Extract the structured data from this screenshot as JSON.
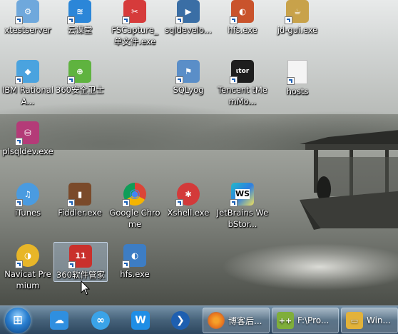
{
  "desktop": {
    "icons": [
      {
        "label": "xtestserver",
        "icon": "xtestserver-icon",
        "color": "#6fa8dc",
        "glyph": "⚙"
      },
      {
        "label": "云课堂",
        "icon": "cloud-classroom-icon",
        "color": "#2b86d8",
        "glyph": "≋"
      },
      {
        "label": "FSCapture_单文件.exe",
        "icon": "fscapture-icon",
        "color": "#d63b3b",
        "glyph": "✂"
      },
      {
        "label": "sqldevelo...",
        "icon": "sqldeveloper-icon",
        "color": "#3a6ea5",
        "glyph": "▶"
      },
      {
        "label": "hfs.exe",
        "icon": "hfs-icon",
        "color": "#c9532c",
        "glyph": "◐"
      },
      {
        "label": "jd-gui.exe",
        "icon": "jd-gui-icon",
        "color": "#c8a24a",
        "glyph": "☕"
      },
      {
        "label": "IBM Rational A...",
        "icon": "ibm-rational-icon",
        "color": "#4aa3df",
        "glyph": "◆"
      },
      {
        "label": "360安全卫士",
        "icon": "360-security-icon",
        "color": "#5fb33f",
        "glyph": "⊕"
      },
      {
        "label": "SQLyog",
        "icon": "sqlyog-icon",
        "color": "#5a8ec8",
        "glyph": "⚑"
      },
      {
        "label": "Tencent tMemMo...",
        "icon": "tencent-tmemmonitor-icon",
        "color": "#1e1e1e",
        "glyph": "ιtor"
      },
      {
        "label": "hosts",
        "icon": "hosts-file-icon",
        "color": "#f4f4f4",
        "glyph": ""
      },
      {
        "label": "plsqldev.exe",
        "icon": "plsqldev-icon",
        "color": "#b43b78",
        "glyph": "⛁"
      },
      {
        "label": "iTunes",
        "icon": "itunes-icon",
        "color": "#4a9be0",
        "glyph": "♫"
      },
      {
        "label": "Fiddler.exe",
        "icon": "fiddler-icon",
        "color": "#7a4a2a",
        "glyph": "▮"
      },
      {
        "label": "Google Chrome",
        "icon": "chrome-icon",
        "color": "#db4437",
        "glyph": "◉"
      },
      {
        "label": "Xshell.exe",
        "icon": "xshell-icon",
        "color": "#d33a3a",
        "glyph": "✱"
      },
      {
        "label": "JetBrains WebStor...",
        "icon": "webstorm-icon",
        "color": "#22b9c9",
        "glyph": "WS"
      },
      {
        "label": "Navicat Premium",
        "icon": "navicat-icon",
        "color": "#e8b628",
        "glyph": "◑"
      },
      {
        "label": "360软件管家",
        "icon": "360-software-manager-icon",
        "color": "#c9302c",
        "glyph": "11"
      },
      {
        "label": "hfs.exe",
        "icon": "hfs-icon",
        "color": "#3d7dc4",
        "glyph": "◐"
      }
    ]
  },
  "taskbar": {
    "start": {
      "icon": "windows-start-icon",
      "glyph": "⊞"
    },
    "pinned": [
      {
        "icon": "pinned-app-blue-icon",
        "color": "#2f8fe0",
        "glyph": "☁"
      },
      {
        "icon": "pinned-app-circle-icon",
        "color": "#3aa3e8",
        "glyph": "∞"
      },
      {
        "icon": "pinned-app-w-icon",
        "color": "#1f8ee6",
        "glyph": "W"
      },
      {
        "icon": "pinned-app-round-icon",
        "color": "#1e5fb0",
        "glyph": "❯"
      }
    ],
    "tasks": [
      {
        "label": "博客后...",
        "icon": "firefox-icon",
        "color": "#e8741d",
        "glyph": "◉"
      },
      {
        "label": "F:\\Pro...",
        "icon": "notepad-plus-icon",
        "color": "#7fae3a",
        "glyph": "++"
      },
      {
        "label": "Win...",
        "icon": "windows-explorer-icon",
        "color": "#e2b23a",
        "glyph": "▭"
      }
    ]
  }
}
